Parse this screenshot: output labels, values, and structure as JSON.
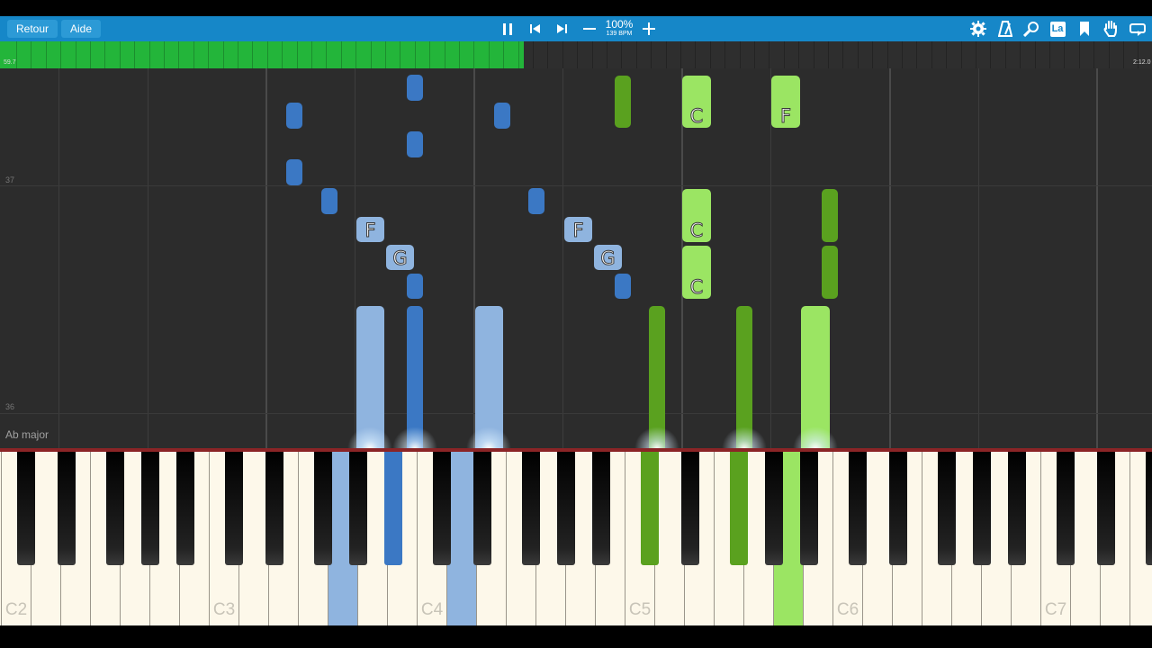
{
  "toolbar": {
    "back_label": "Retour",
    "help_label": "Aide",
    "speed_percent": "100%",
    "speed_bpm": "139 BPM",
    "note_label_button": "La"
  },
  "timeline": {
    "start_time": "59.7",
    "end_time": "2:12.0",
    "progress": 0.455,
    "fill_color": "#23b53a"
  },
  "roll": {
    "measure_numbers": [
      "37",
      "36"
    ],
    "key_signature": "Ab major"
  },
  "notes": [
    {
      "hand": "left",
      "label": "F"
    },
    {
      "hand": "left",
      "label": "G"
    },
    {
      "hand": "left",
      "label": "F"
    },
    {
      "hand": "left",
      "label": "G"
    },
    {
      "hand": "right",
      "label": "C"
    },
    {
      "hand": "right",
      "label": "C"
    },
    {
      "hand": "right",
      "label": "C"
    },
    {
      "hand": "right",
      "label": "F"
    }
  ],
  "keyboard": {
    "octave_labels": [
      "C2",
      "C3",
      "C4",
      "C5",
      "C6",
      "C7"
    ]
  },
  "colors": {
    "toolbar": "#1687c8",
    "left_hand_light": "#8fb4df",
    "left_hand_dark": "#3b78c4",
    "right_hand_light": "#9be563",
    "right_hand_dark": "#5aa11f"
  }
}
